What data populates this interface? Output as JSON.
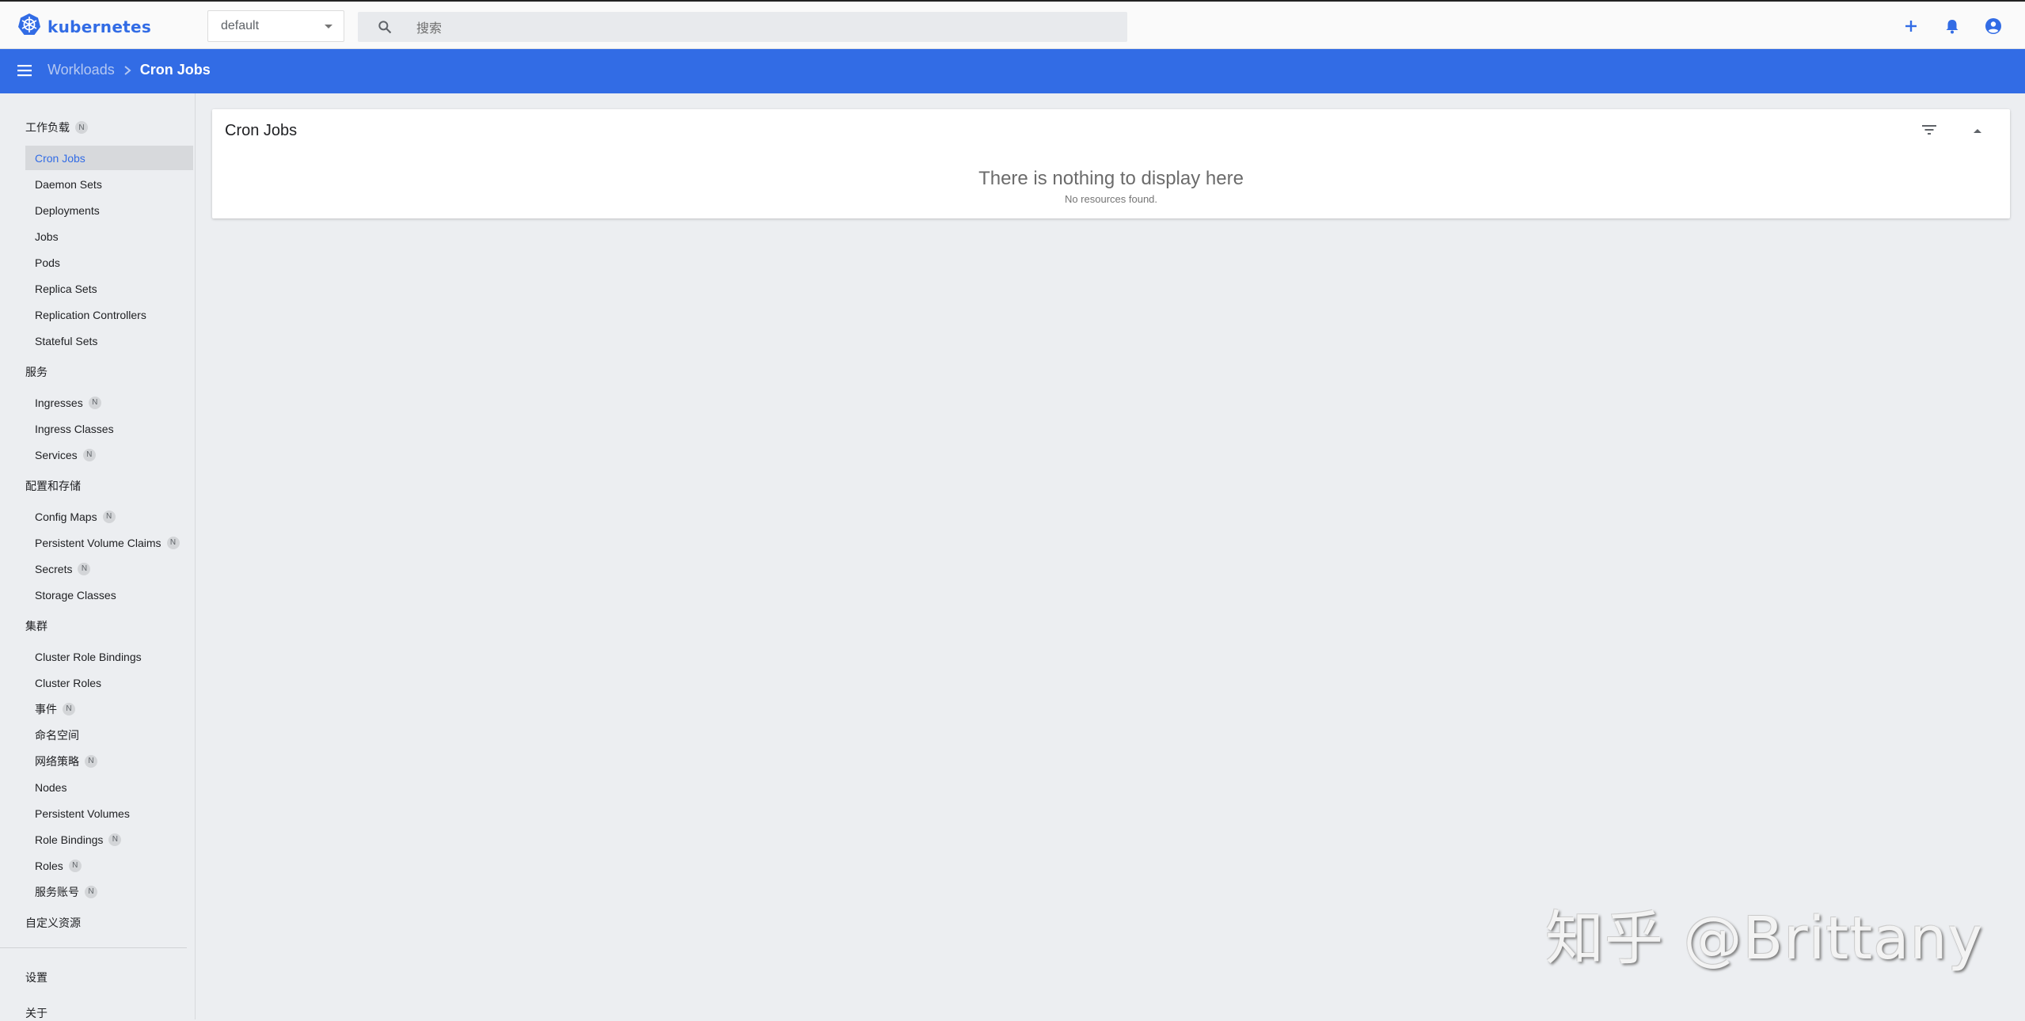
{
  "header": {
    "logo_text": "kubernetes",
    "namespace_value": "default",
    "search_placeholder": "搜索",
    "icons": [
      "kubernetes-logo-icon",
      "search-icon",
      "add-icon",
      "bell-icon",
      "account-icon"
    ]
  },
  "breadcrumb": {
    "parent": "Workloads",
    "current": "Cron Jobs"
  },
  "sidebar": {
    "sections": [
      {
        "label": "工作负载",
        "badge": "N"
      },
      {
        "label": "服务"
      },
      {
        "label": "配置和存储"
      },
      {
        "label": "集群"
      },
      {
        "label": "自定义资源"
      },
      {
        "label": "设置"
      },
      {
        "label": "关于"
      }
    ],
    "items": [
      {
        "label": "Cron Jobs",
        "active": true
      },
      {
        "label": "Daemon Sets"
      },
      {
        "label": "Deployments"
      },
      {
        "label": "Jobs"
      },
      {
        "label": "Pods"
      },
      {
        "label": "Replica Sets"
      },
      {
        "label": "Replication Controllers"
      },
      {
        "label": "Stateful Sets"
      },
      {
        "label": "Ingresses",
        "badge": "N"
      },
      {
        "label": "Ingress Classes"
      },
      {
        "label": "Services",
        "badge": "N"
      },
      {
        "label": "Config Maps",
        "badge": "N"
      },
      {
        "label": "Persistent Volume Claims",
        "badge": "N"
      },
      {
        "label": "Secrets",
        "badge": "N"
      },
      {
        "label": "Storage Classes"
      },
      {
        "label": "Cluster Role Bindings"
      },
      {
        "label": "Cluster Roles"
      },
      {
        "label": "事件",
        "badge": "N"
      },
      {
        "label": "命名空间"
      },
      {
        "label": "网络策略",
        "badge": "N"
      },
      {
        "label": "Nodes"
      },
      {
        "label": "Persistent Volumes"
      },
      {
        "label": "Role Bindings",
        "badge": "N"
      },
      {
        "label": "Roles",
        "badge": "N"
      },
      {
        "label": "服务账号",
        "badge": "N"
      }
    ]
  },
  "card": {
    "title": "Cron Jobs",
    "empty_title": "There is nothing to display here",
    "empty_subtitle": "No resources found."
  },
  "watermark": "知乎 @Brittany",
  "colors": {
    "brand_blue": "#326ce5",
    "background": "#eceef1",
    "active_item_bg": "#d7d9dc"
  }
}
